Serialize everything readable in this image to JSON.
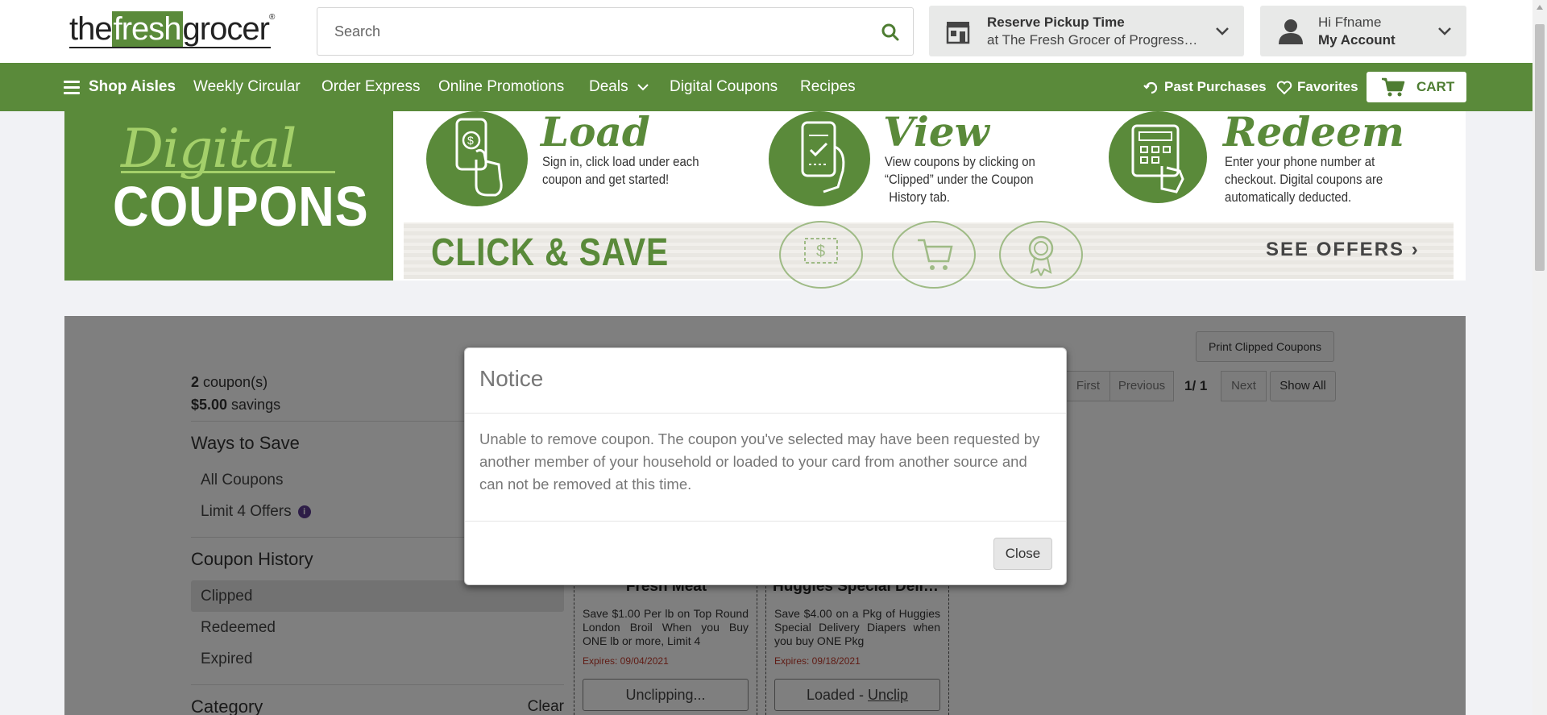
{
  "header": {
    "logo_the": "the",
    "logo_fresh": "fresh",
    "logo_grocer": "grocer",
    "logo_mark": "®",
    "search_placeholder": "Search",
    "pickup_title": "Reserve Pickup Time",
    "pickup_store": "at The Fresh Grocer of Progress Pl...",
    "greeting": "Hi Ffname",
    "account_label": "My Account"
  },
  "nav": {
    "shop_aisles": "Shop Aisles",
    "weekly_circular": "Weekly Circular",
    "order_express": "Order Express",
    "online_promotions": "Online Promotions",
    "deals": "Deals",
    "digital_coupons": "Digital Coupons",
    "recipes": "Recipes",
    "past_purchases": "Past Purchases",
    "favorites": "Favorites",
    "cart": "CART"
  },
  "banner": {
    "digital": "Digital",
    "coupons": "COUPONS",
    "steps": [
      {
        "title": "Load",
        "desc_1": "Sign in, click load under each",
        "desc_2": "coupon and get started!",
        "desc_3": ""
      },
      {
        "title": "View",
        "desc_1": "View coupons by clicking on",
        "desc_2": "“Clipped” under the Coupon",
        "desc_3": "History tab."
      },
      {
        "title": "Redeem",
        "desc_1": "Enter your phone number at",
        "desc_2": "checkout. Digital coupons are",
        "desc_3": "automatically deducted."
      }
    ],
    "click_save": "CLICK & SAVE",
    "see_offers": "SEE OFFERS ›"
  },
  "summary": {
    "count": "2",
    "count_label": " coupon(s)",
    "savings": "$5.00",
    "savings_label": " savings"
  },
  "sidebar": {
    "ways_to_save": "Ways to Save",
    "all_coupons": "All Coupons",
    "limit_offers": "Limit 4 Offers",
    "coupon_history": "Coupon History",
    "clipped": "Clipped",
    "redeemed": "Redeemed",
    "expired": "Expired",
    "category": "Category",
    "clear": "Clear"
  },
  "pager": {
    "print": "Print Clipped Coupons",
    "first": "First",
    "previous": "Previous",
    "page": "1/ 1",
    "next": "Next",
    "show_all": "Show All"
  },
  "coupons": [
    {
      "title": "Fresh Meat",
      "desc": "Save $1.00 Per lb on Top Round London Broil When you Buy ONE lb or more, Limit 4",
      "expires": "Expires: 09/04/2021",
      "button": "Unclipping..."
    },
    {
      "title": "Huggies Special Delivery",
      "desc": "Save $4.00 on a Pkg of Huggies Special Delivery Diapers when you buy ONE Pkg",
      "expires": "Expires: 09/18/2021",
      "button_prefix": "Loaded - ",
      "button_link": "Unclip"
    }
  ],
  "modal": {
    "title": "Notice",
    "body": "Unable to remove coupon. The coupon you've selected may have been requested by another member of your household or loaded to your card from another source and can not be removed at this time.",
    "close": "Close"
  },
  "colors": {
    "brand_green": "#5a8a3a",
    "light_green": "#a4d06a",
    "expiry_red": "#c0392b"
  }
}
